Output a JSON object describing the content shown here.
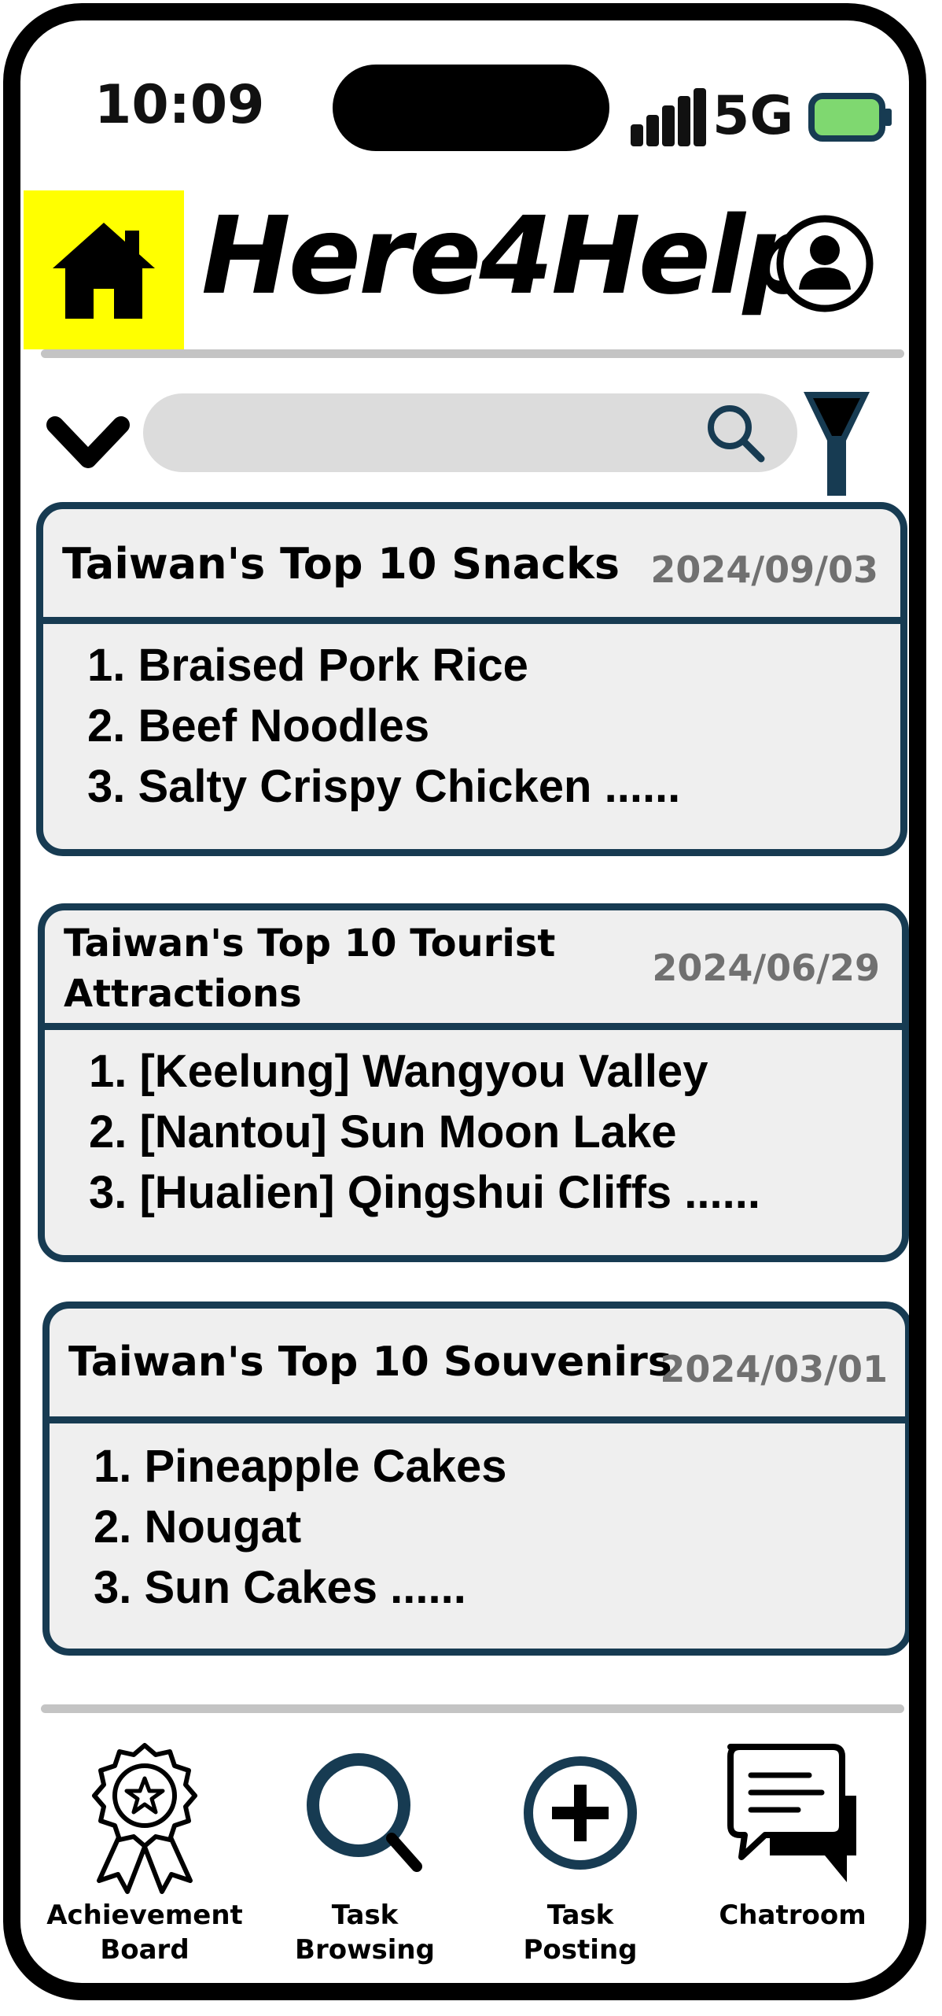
{
  "status_bar": {
    "time": "10:09",
    "network": "5G",
    "battery_color": "#7fd870"
  },
  "header": {
    "brand": "Here4Help",
    "home_highlight": "#ffff00"
  },
  "search": {
    "placeholder": ""
  },
  "cards": [
    {
      "title": "Taiwan's Top 10 Snacks",
      "date": "2024/09/03",
      "items": [
        "1. Braised Pork Rice",
        "2. Beef Noodles",
        "3. Salty Crispy Chicken  ......"
      ]
    },
    {
      "title_line1": "Taiwan's Top 10 Tourist",
      "title_line2": "Attractions",
      "date": "2024/06/29",
      "items": [
        "1. [Keelung] Wangyou Valley",
        "2. [Nantou] Sun Moon Lake",
        "3. [Hualien] Qingshui Cliffs ......"
      ]
    },
    {
      "title": "Taiwan's Top 10 Souvenirs",
      "date": "2024/03/01",
      "items": [
        "1. Pineapple Cakes",
        "2. Nougat",
        "3. Sun Cakes ......"
      ]
    }
  ],
  "bottom_nav": [
    {
      "label": "Achievement\nBoard",
      "icon": "award-badge-icon"
    },
    {
      "label": "Task\nBrowsing",
      "icon": "magnifier-icon"
    },
    {
      "label": "Task\nPosting",
      "icon": "plus-circle-icon"
    },
    {
      "label": "Chatroom",
      "icon": "chat-bubbles-icon"
    }
  ],
  "colors": {
    "card_border": "#173b52",
    "card_bg": "#efefef",
    "date_text": "#707070",
    "divider": "#c4c4c4"
  }
}
